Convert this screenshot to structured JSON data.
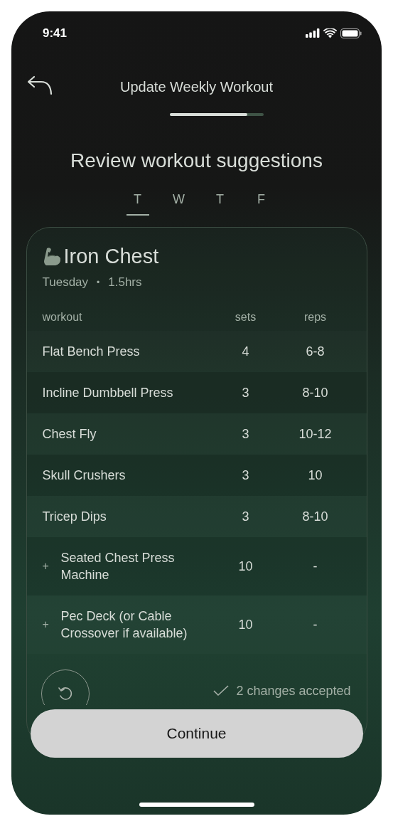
{
  "status_bar": {
    "time": "9:41"
  },
  "header": {
    "title": "Update Weekly Workout",
    "progress": {
      "level": 0.83
    }
  },
  "heading": "Review workout suggestions",
  "day_tabs": [
    {
      "label": "T",
      "selected": true
    },
    {
      "label": "W",
      "selected": false
    },
    {
      "label": "T",
      "selected": false
    },
    {
      "label": "F",
      "selected": false
    }
  ],
  "card": {
    "title": "Iron Chest",
    "day": "Tuesday",
    "separator": "•",
    "duration": "1.5hrs",
    "columns": [
      "workout",
      "sets",
      "reps"
    ],
    "rows": [
      {
        "kind": "plan",
        "name": "Flat Bench Press",
        "sets": "4",
        "reps": "6-8"
      },
      {
        "kind": "plan",
        "name": "Incline Dumbbell Press",
        "sets": "3",
        "reps": "8-10"
      },
      {
        "kind": "plan",
        "name": "Chest Fly",
        "sets": "3",
        "reps": "10-12"
      },
      {
        "kind": "plan",
        "name": "Skull Crushers",
        "sets": "3",
        "reps": "10"
      },
      {
        "kind": "plan",
        "name": "Tricep Dips",
        "sets": "3",
        "reps": "8-10"
      },
      {
        "kind": "added",
        "marker": "+",
        "name": "Seated Chest Press Machine",
        "sets": "10",
        "reps": "-"
      },
      {
        "kind": "added",
        "marker": "+",
        "name": "Pec Deck (or Cable Crossover if available)",
        "sets": "10",
        "reps": "-"
      }
    ],
    "status": "2 changes accepted"
  },
  "continue_button": "Continue"
}
